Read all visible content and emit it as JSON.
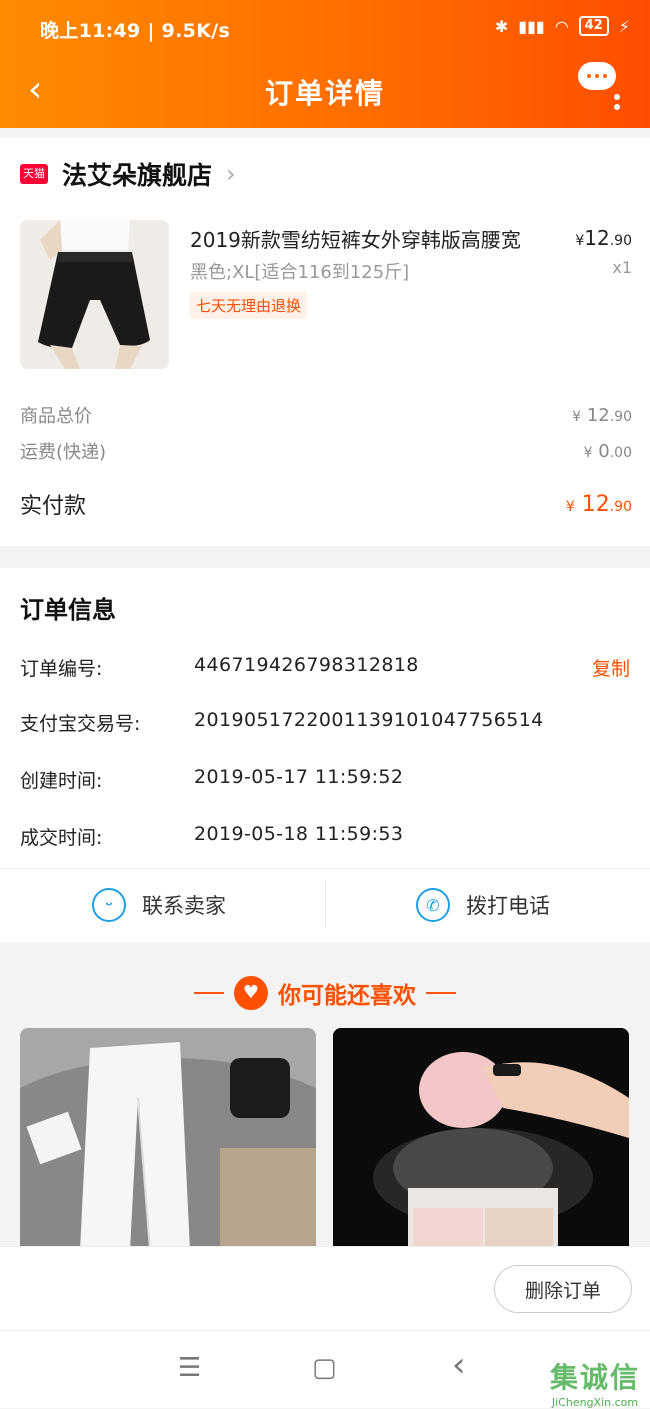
{
  "status_bar": {
    "time_speed": "晚上11:49 | 9.5K/s",
    "battery": "42",
    "icons": [
      "moon-icon",
      "notification-icon",
      "bluetooth-icon",
      "signal-icon",
      "wifi-icon",
      "battery-icon",
      "charging-icon"
    ]
  },
  "nav": {
    "title": "订单详情",
    "back_icon": "chevron-left-icon",
    "more_icon": "more-icon"
  },
  "shop": {
    "badge": "天猫",
    "name": "法艾朵旗舰店"
  },
  "product": {
    "title": "2019新款雪纺短裤女外穿韩版高腰宽",
    "spec": "黑色;XL[适合116到125斤]",
    "tag": "七天无理由退换",
    "price_yuan": "¥",
    "price_int": "12",
    "price_dec": ".90",
    "qty": "x1"
  },
  "summary": {
    "goods_label": "商品总价",
    "goods_int": "12",
    "goods_dec": ".90",
    "ship_label": "运费(快递)",
    "ship_int": "0",
    "ship_dec": ".00",
    "paid_label": "实付款",
    "paid_int": "12",
    "paid_dec": ".90",
    "currency": "¥"
  },
  "order_info": {
    "heading": "订单信息",
    "rows": [
      {
        "label": "订单编号:",
        "value": "446719426798312818"
      },
      {
        "label": "支付宝交易号:",
        "value": "2019051722001139101047756514"
      },
      {
        "label": "创建时间:",
        "value": "2019-05-17 11:59:52"
      },
      {
        "label": "成交时间:",
        "value": "2019-05-18 11:59:53"
      }
    ],
    "copy_label": "复制"
  },
  "actions": {
    "contact_seller": "联系卖家",
    "call_phone": "拨打电话"
  },
  "recommend": {
    "title": "你可能还喜欢"
  },
  "bottom": {
    "delete_order": "删除订单"
  },
  "system_nav": {
    "menu": "☰",
    "home": "▢",
    "back": "‹"
  },
  "watermark": {
    "name": "集诚信",
    "site": "JiChengXin.com"
  },
  "colors": {
    "accent": "#ff5000",
    "header_start": "#ff8a00",
    "header_end": "#ff4e00",
    "tmall_red": "#ff0036",
    "icon_blue": "#1e9fe6"
  }
}
